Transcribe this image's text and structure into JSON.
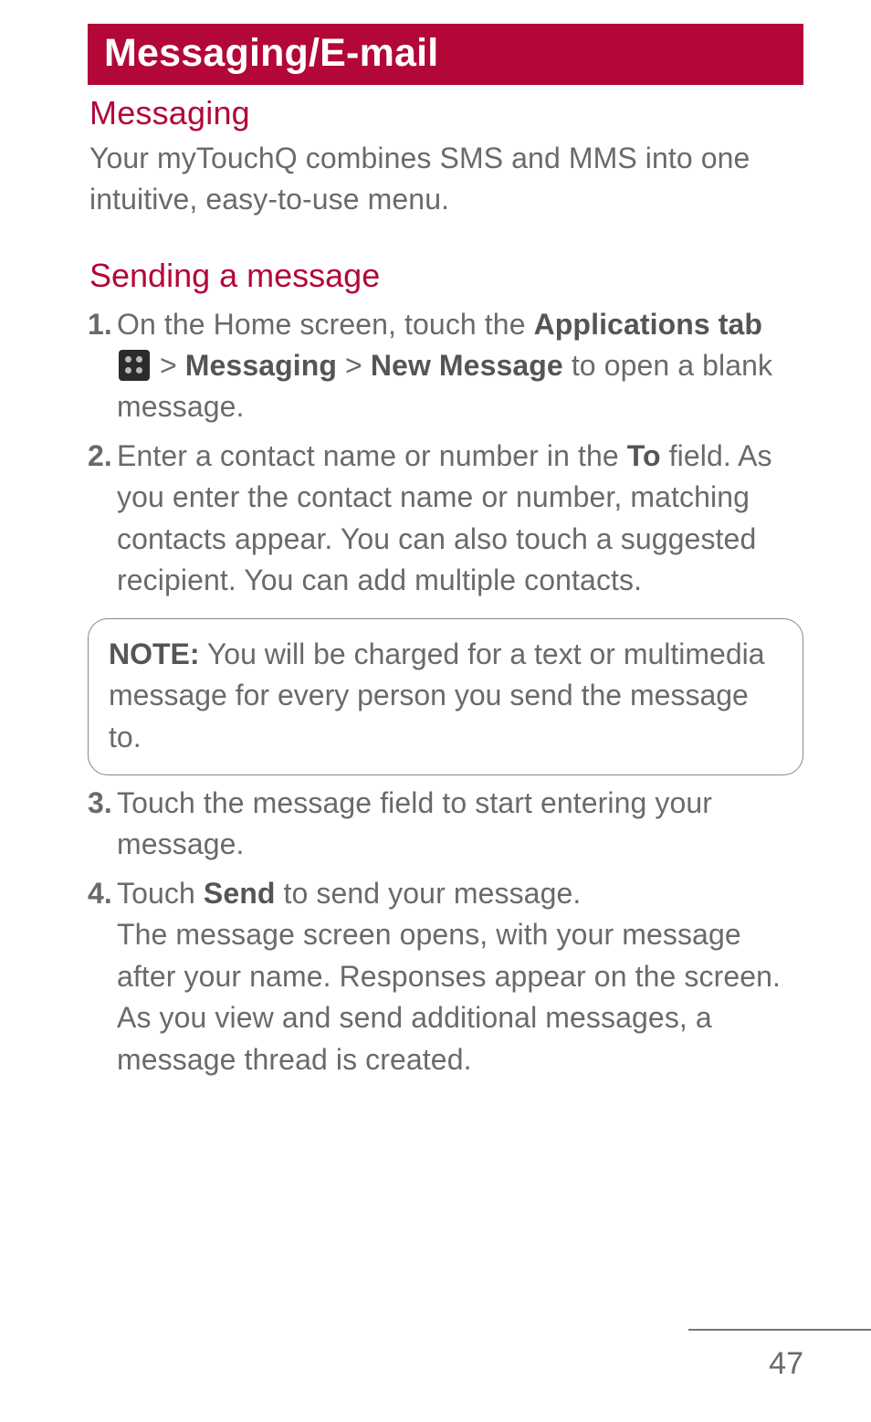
{
  "chapter_title": "Messaging/E-mail",
  "section": {
    "heading": "Messaging",
    "intro": "Your myTouchQ combines SMS and MMS into one intuitive, easy-to-use menu."
  },
  "subsection": {
    "heading": "Sending a message",
    "steps": [
      {
        "num": "1.",
        "pre": " On the Home screen, touch the ",
        "b1": "Applications tab",
        "after_icon_gt": " > ",
        "b2": "Messaging",
        "gt2": " > ",
        "b3": "New Message",
        "tail": " to open a blank message."
      },
      {
        "num": "2.",
        "pre": "Enter a contact name or number in the ",
        "b1": "To",
        "tail": " field. As you enter the contact name or number, matching contacts appear. You can also touch a suggested recipient. You can add multiple contacts."
      },
      {
        "num": "3.",
        "tail": "Touch the message field to start entering your message."
      },
      {
        "num": "4.",
        "pre": "Touch ",
        "b1": "Send",
        "tail": " to send your message.\nThe message screen opens, with your message after your name. Responses appear on the screen. As you view and send additional messages, a message thread is created."
      }
    ]
  },
  "note": {
    "label": "NOTE:",
    "text": " You will be charged for a text or multimedia message for every person you send the message to."
  },
  "page_number": "47"
}
